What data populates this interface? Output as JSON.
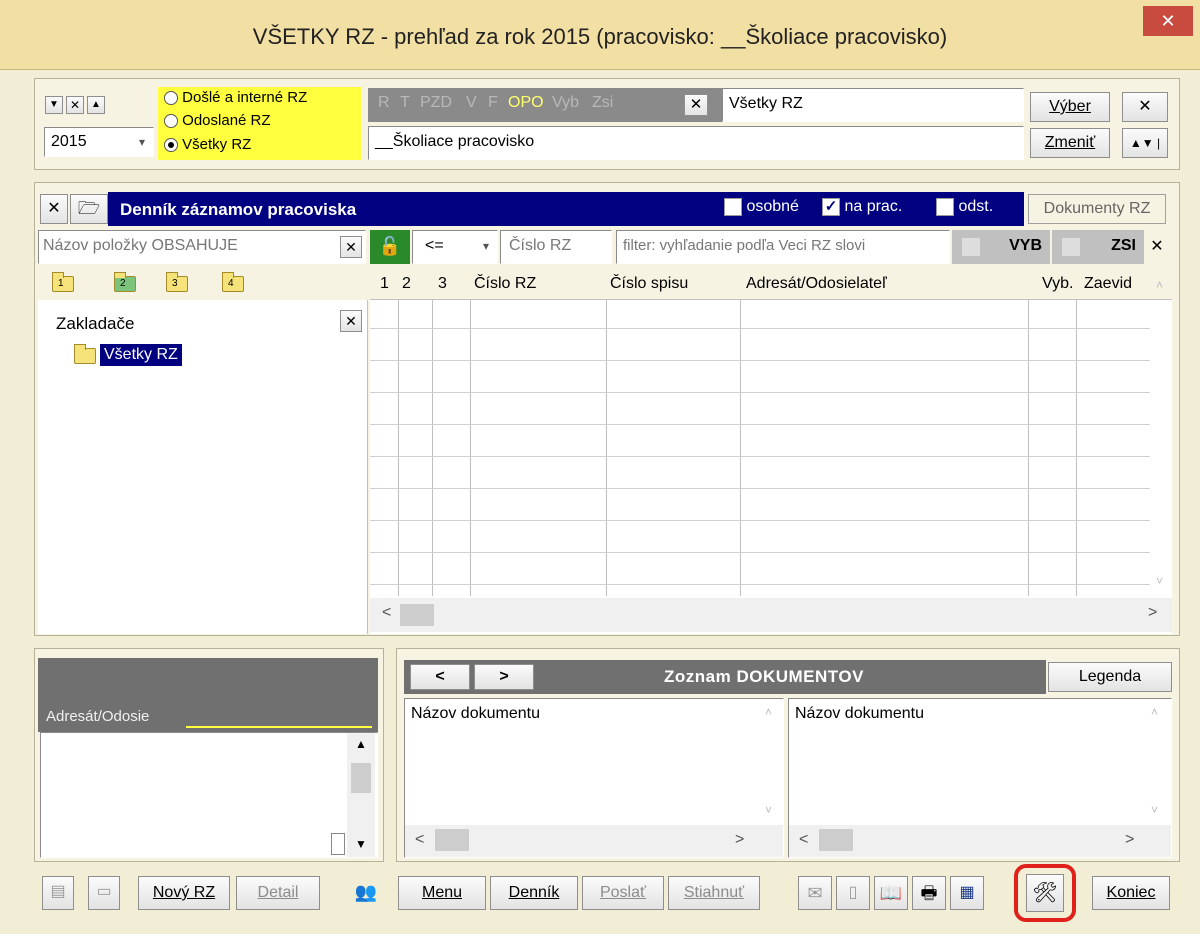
{
  "window": {
    "title": "VŠETKY RZ - prehľad za rok 2015 (pracovisko: __Školiace pracovisko)",
    "close_glyph": "✕"
  },
  "filter_bar": {
    "year": "2015",
    "radios": [
      {
        "label": "Došlé a interné RZ",
        "selected": false
      },
      {
        "label": "Odoslané RZ",
        "selected": false
      },
      {
        "label": "Všetky RZ",
        "selected": true
      }
    ],
    "flags": [
      "R",
      "T",
      "PZD",
      "V",
      "F",
      "OPO",
      "Vyb",
      "Zsi"
    ],
    "selection_text": "Všetky RZ",
    "workplace_text": "__Školiace pracovisko",
    "vyber_label": "Výber",
    "zmenit_label": "Zmeniť",
    "close_glyph": "✕"
  },
  "journal": {
    "title": "Denník záznamov pracoviska",
    "checks": [
      {
        "label": "osobné",
        "checked": false
      },
      {
        "label": "na prac.",
        "checked": true
      },
      {
        "label": "odst.",
        "checked": false
      }
    ],
    "documents_button": "Dokumenty RZ",
    "search_placeholder": "Názov položky OBSAHUJE",
    "operator": "<=",
    "number_placeholder": "Číslo RZ",
    "filter_placeholder": "filter: vyhľadanie podľa Veci RZ slovi",
    "vyb_label": "VYB",
    "zsi_label": "ZSI",
    "folder_tabs": [
      "1",
      "2",
      "3",
      "4"
    ],
    "tree_root": "Zakladače",
    "tree_item": "Všetky RZ",
    "columns": [
      "1",
      "2",
      "3",
      "Číslo RZ",
      "Číslo spisu",
      "Adresát/Odosielateľ",
      "Vyb.",
      "Zaevid"
    ]
  },
  "address_panel": {
    "label": "Adresát/Odosie"
  },
  "documents": {
    "title": "Zoznam DOKUMENTOV",
    "legend_button": "Legenda",
    "col_left": "Názov dokumentu",
    "col_right": "Názov dokumentu"
  },
  "bottom_bar": {
    "novy": "Nový RZ",
    "detail": "Detail",
    "menu": "Menu",
    "dennik": "Denník",
    "poslat": "Poslať",
    "stiahnut": "Stiahnuť",
    "koniec": "Koniec",
    "highlight_color": "#e0201b"
  }
}
